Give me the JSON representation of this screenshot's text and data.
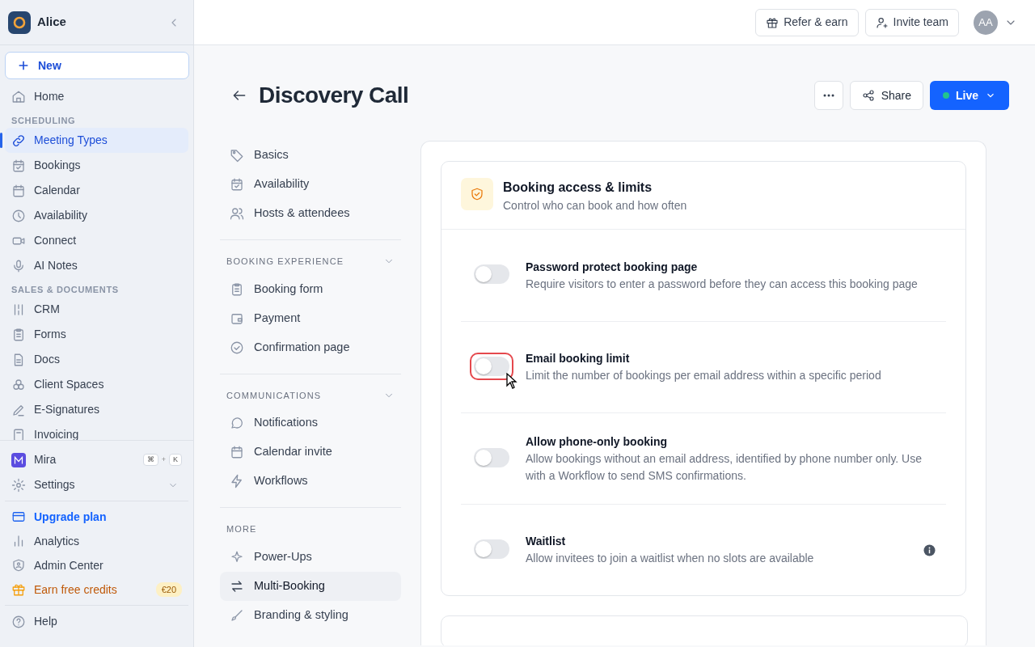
{
  "sidebar": {
    "workspace": "Alice",
    "new_button": "New",
    "nav": [
      {
        "kind": "item",
        "label": "Home",
        "selected": false
      },
      {
        "kind": "heading",
        "label": "SCHEDULING"
      },
      {
        "kind": "item",
        "label": "Meeting Types",
        "selected": true
      },
      {
        "kind": "item",
        "label": "Bookings",
        "selected": false
      },
      {
        "kind": "item",
        "label": "Calendar",
        "selected": false
      },
      {
        "kind": "item",
        "label": "Availability",
        "selected": false
      },
      {
        "kind": "item",
        "label": "Connect",
        "selected": false
      },
      {
        "kind": "item",
        "label": "AI Notes",
        "selected": false
      },
      {
        "kind": "heading",
        "label": "SALES & DOCUMENTS"
      },
      {
        "kind": "item",
        "label": "CRM",
        "selected": false
      },
      {
        "kind": "item",
        "label": "Forms",
        "selected": false
      },
      {
        "kind": "item",
        "label": "Docs",
        "selected": false
      },
      {
        "kind": "item",
        "label": "Client Spaces",
        "selected": false
      },
      {
        "kind": "item",
        "label": "E-Signatures",
        "selected": false
      },
      {
        "kind": "item",
        "label": "Invoicing",
        "selected": false
      }
    ],
    "assistant": {
      "label": "Mira",
      "keys": [
        "⌘",
        "+",
        "K"
      ]
    },
    "settings": {
      "label": "Settings",
      "expanded": false
    },
    "links": [
      {
        "kind": "upgrade",
        "label": "Upgrade plan"
      },
      {
        "kind": "plain",
        "label": "Analytics"
      },
      {
        "kind": "plain",
        "label": "Admin Center"
      },
      {
        "kind": "credits",
        "label": "Earn free credits",
        "badge": "€20"
      }
    ],
    "help": "Help"
  },
  "topbar": {
    "buttons": [
      "Refer & earn",
      "Invite team"
    ],
    "avatar": "AA"
  },
  "page": {
    "title": "Discovery Call",
    "share": "Share",
    "status": "Live"
  },
  "subnav": [
    {
      "items": [
        {
          "label": "Basics",
          "selected": false
        },
        {
          "label": "Availability",
          "selected": false
        },
        {
          "label": "Hosts & attendees",
          "selected": false
        }
      ]
    },
    {
      "heading": "BOOKING EXPERIENCE",
      "items": [
        {
          "label": "Booking form",
          "selected": false
        },
        {
          "label": "Payment",
          "selected": false
        },
        {
          "label": "Confirmation page",
          "selected": false
        }
      ]
    },
    {
      "heading": "COMMUNICATIONS",
      "items": [
        {
          "label": "Notifications",
          "selected": false
        },
        {
          "label": "Calendar invite",
          "selected": false
        },
        {
          "label": "Workflows",
          "selected": false
        }
      ]
    },
    {
      "heading": "MORE",
      "items": [
        {
          "label": "Power-Ups",
          "selected": false
        },
        {
          "label": "Multi-Booking",
          "selected": true
        },
        {
          "label": "Branding & styling",
          "selected": false
        }
      ]
    }
  ],
  "section": {
    "title": "Booking access & limits",
    "subtitle": "Control who can book and how often",
    "settings": [
      {
        "title": "Password protect booking page",
        "description": "Require visitors to enter a password before they can access this booking page",
        "on": false,
        "info": false,
        "kind": "plain"
      },
      {
        "title": "Email booking limit",
        "description": "Limit the number of bookings per email address within a specific period",
        "on": false,
        "info": false,
        "kind": "focused"
      },
      {
        "title": "Allow phone-only booking",
        "description": "Allow bookings without an email address, identified by phone number only. Use with a Workflow to send SMS confirmations.",
        "on": false,
        "info": false,
        "kind": "plain"
      },
      {
        "title": "Waitlist",
        "description": "Allow invitees to join a waitlist when no slots are available",
        "on": false,
        "info": true,
        "kind": "plain"
      }
    ]
  }
}
